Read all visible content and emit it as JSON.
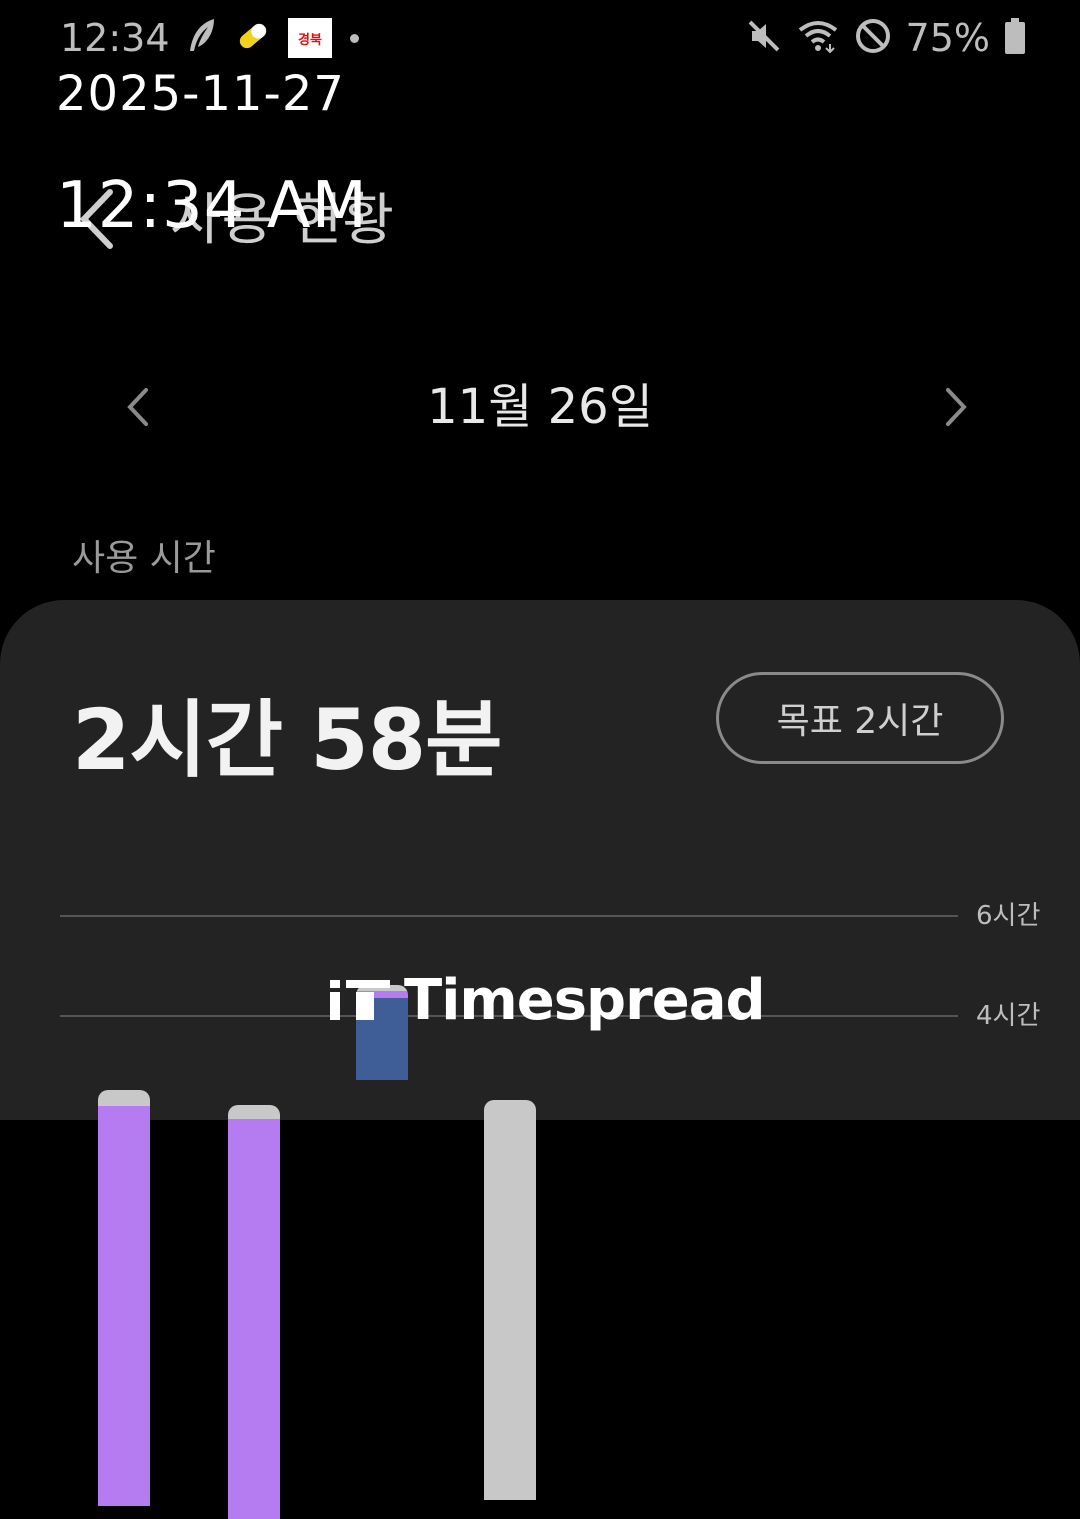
{
  "status_bar": {
    "time": "12:34",
    "battery_text": "75%",
    "icons": [
      "feather-icon",
      "pill-icon",
      "news-app-icon",
      "more-dot-icon",
      "mute-icon",
      "wifi-icon",
      "dnd-icon",
      "battery-icon"
    ],
    "news_icon_text": "경북"
  },
  "overlay": {
    "date": "2025-11-27",
    "time": "12:34 AM"
  },
  "app_bar": {
    "title": "사용 현황"
  },
  "date_nav": {
    "date": "11월 26일"
  },
  "section": {
    "label": "사용 시간"
  },
  "summary": {
    "total": "2시간 58분",
    "goal_label": "목표 2시간"
  },
  "colors": {
    "card_bg": "#232323",
    "purple": "#b47cf0",
    "blue": "#3f5e98",
    "gray": "#c8c8c8"
  },
  "chart_data": {
    "type": "bar",
    "stacked": true,
    "y_ticks": [
      "6시간",
      "4시간"
    ],
    "ylim_hours": [
      0,
      6
    ],
    "bars": [
      {
        "segments": [
          {
            "color": "purple"
          },
          {
            "color": "gray"
          }
        ],
        "top_hours": 2.5
      },
      {
        "segments": [
          {
            "color": "purple"
          },
          {
            "color": "gray"
          }
        ],
        "top_hours": 2.2
      },
      {
        "segments": [
          {
            "color": "blue"
          },
          {
            "color": "purple"
          },
          {
            "color": "gray"
          }
        ],
        "top_hours": 4.6
      },
      {
        "segments": [
          {
            "color": "gray"
          }
        ],
        "top_hours": 2.3
      }
    ]
  },
  "watermark": {
    "text": "Timespread"
  }
}
